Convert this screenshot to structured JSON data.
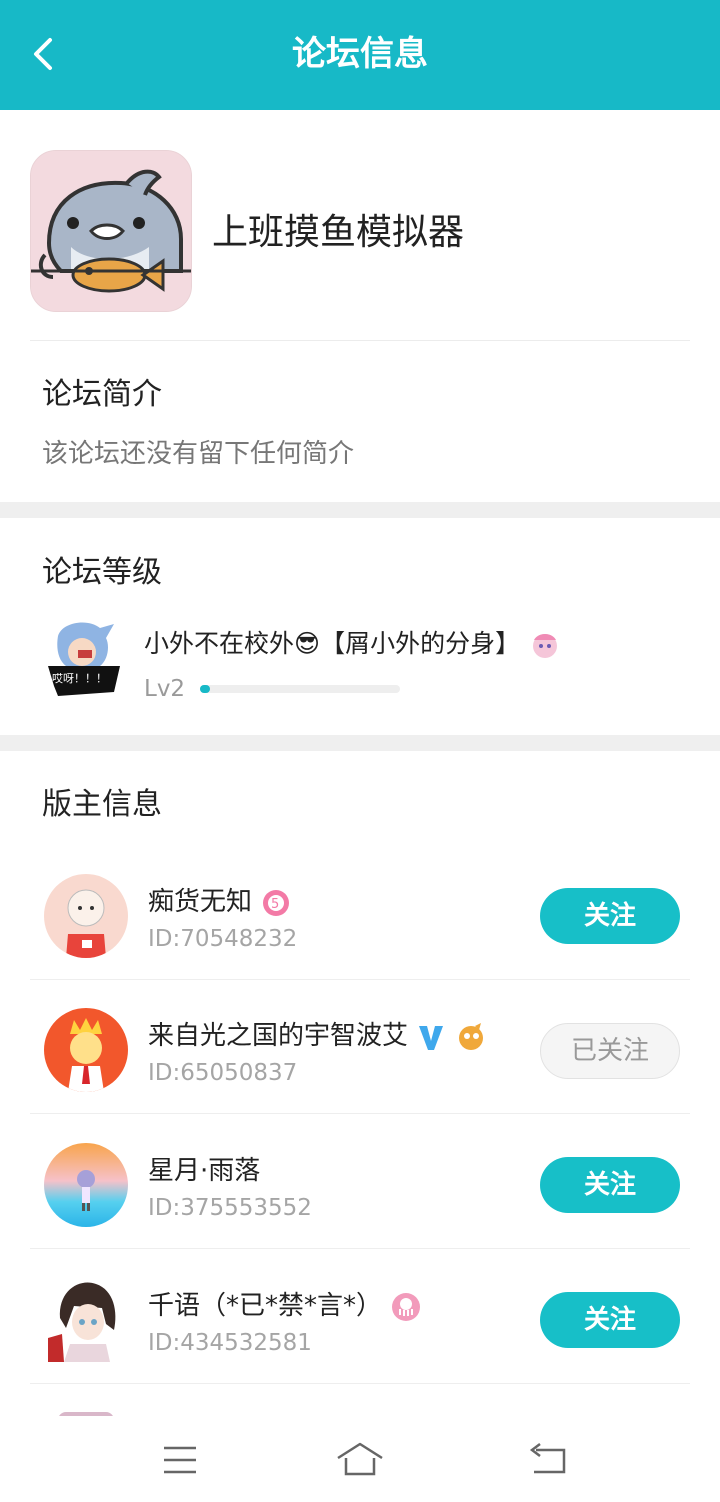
{
  "header": {
    "title": "论坛信息",
    "back_icon": "chevron-left-icon"
  },
  "forum": {
    "name": "上班摸鱼模拟器",
    "logo_icon": "shark-mascot-logo"
  },
  "intro": {
    "title": "论坛简介",
    "text": "该论坛还没有留下任何简介"
  },
  "level_section": {
    "title": "论坛等级",
    "owner_name": "小外不在校外😎【屑小外的分身】",
    "level": "Lv2",
    "progress_fraction": 0.05,
    "avatar_caption": "哎呀！！！"
  },
  "moderators": {
    "title": "版主信息",
    "items": [
      {
        "name": "痴货无知",
        "id": "ID:70548232",
        "button": "关注",
        "followed": false
      },
      {
        "name": "来自光之国的宇智波艾",
        "id": "ID:65050837",
        "button": "已关注",
        "followed": true
      },
      {
        "name": "星月·雨落",
        "id": "ID:375553552",
        "button": "关注",
        "followed": false
      },
      {
        "name": "千语（*已*禁*言*）",
        "id": "ID:434532581",
        "button": "关注",
        "followed": false
      }
    ]
  },
  "colors": {
    "accent": "#17b9c7",
    "divider_gap": "#efefef"
  },
  "navbar": {
    "icons": [
      "menu-icon",
      "home-icon",
      "return-icon"
    ]
  }
}
